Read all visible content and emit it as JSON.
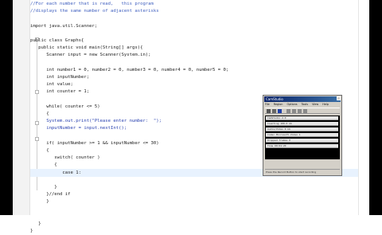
{
  "editor": {
    "lines": [
      {
        "text": "//For each number that is read,   this program",
        "type": "comment"
      },
      {
        "text": "//displays the same number of adjacent asterisks",
        "type": "comment"
      },
      {
        "text": "",
        "type": "code"
      },
      {
        "text": "import java.util.Scanner;",
        "type": "code"
      },
      {
        "text": "",
        "type": "code"
      },
      {
        "text": "public class Graphs{",
        "type": "code"
      },
      {
        "text": "   public static void main(String[] args){",
        "type": "code"
      },
      {
        "text": "      Scanner input = new Scanner(System.in);",
        "type": "code"
      },
      {
        "text": "",
        "type": "code"
      },
      {
        "text": "      int number1 = 0, number2 = 0, number3 = 0, number4 = 0, number5 = 0;",
        "type": "code"
      },
      {
        "text": "      int inputNumber;",
        "type": "code"
      },
      {
        "text": "      int value;",
        "type": "code"
      },
      {
        "text": "      int counter = 1;",
        "type": "code"
      },
      {
        "text": "",
        "type": "code"
      },
      {
        "text": "      while( counter <= 5)",
        "type": "code"
      },
      {
        "text": "      {",
        "type": "code"
      },
      {
        "text": "      System.out.print(\"Please enter number:  \");",
        "type": "blue"
      },
      {
        "text": "      inputNumber = input.nextInt();",
        "type": "blue"
      },
      {
        "text": "",
        "type": "code"
      },
      {
        "text": "      if( inputNumber >= 1 && inputNumber <= 30)",
        "type": "code"
      },
      {
        "text": "      {",
        "type": "code"
      },
      {
        "text": "         switch( counter )",
        "type": "code"
      },
      {
        "text": "         {",
        "type": "code"
      },
      {
        "text": "            case 1:",
        "type": "highlight"
      },
      {
        "text": "",
        "type": "code"
      },
      {
        "text": "         }",
        "type": "code"
      },
      {
        "text": "      }//end if",
        "type": "code"
      },
      {
        "text": "      }",
        "type": "code"
      },
      {
        "text": "",
        "type": "code"
      },
      {
        "text": "",
        "type": "code"
      },
      {
        "text": "   }",
        "type": "code"
      },
      {
        "text": "}",
        "type": "code"
      }
    ]
  },
  "counter_window": {
    "title": "CamStudio",
    "menu": [
      "File",
      "Region",
      "Options",
      "Tools",
      "View",
      "Help"
    ],
    "rows": [
      "CamStudio 2.0",
      "Counting  100.0 kb",
      "Audio/Video  0 kb",
      "Codec  Microsoft Video 1",
      "Dropped frames  0",
      "Time  00:01:20"
    ],
    "status": "Press the Record Button to start recording"
  }
}
